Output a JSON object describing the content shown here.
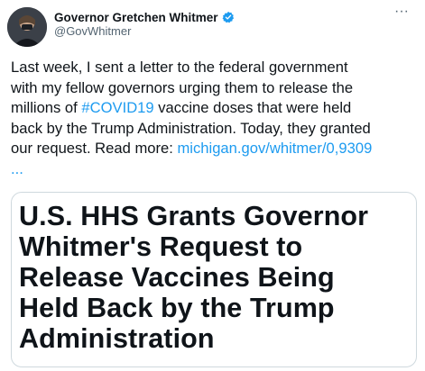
{
  "author": {
    "display_name": "Governor Gretchen Whitmer",
    "handle": "@GovWhitmer",
    "verified": true
  },
  "menu": {
    "more_label": "···"
  },
  "tweet": {
    "lines": [
      "Last week, I sent a letter to the federal government",
      "with my fellow governors urging them to release the",
      "millions of ",
      " vaccine doses that were held",
      "back by the Trump Administration. Today, they granted",
      "our request. Read more: ",
      "..."
    ],
    "hashtag": "#COVID19",
    "link": "michigan.gov/whitmer/0,9309"
  },
  "card": {
    "title_lines": [
      "U.S. HHS Grants Governor",
      "Whitmer's Request to",
      "Release Vaccines Being",
      "Held Back by the Trump",
      "Administration"
    ]
  },
  "colors": {
    "link": "#1d9bf0",
    "verified_badge": "#1d9bf0",
    "text": "#0f1419",
    "secondary": "#536471"
  }
}
